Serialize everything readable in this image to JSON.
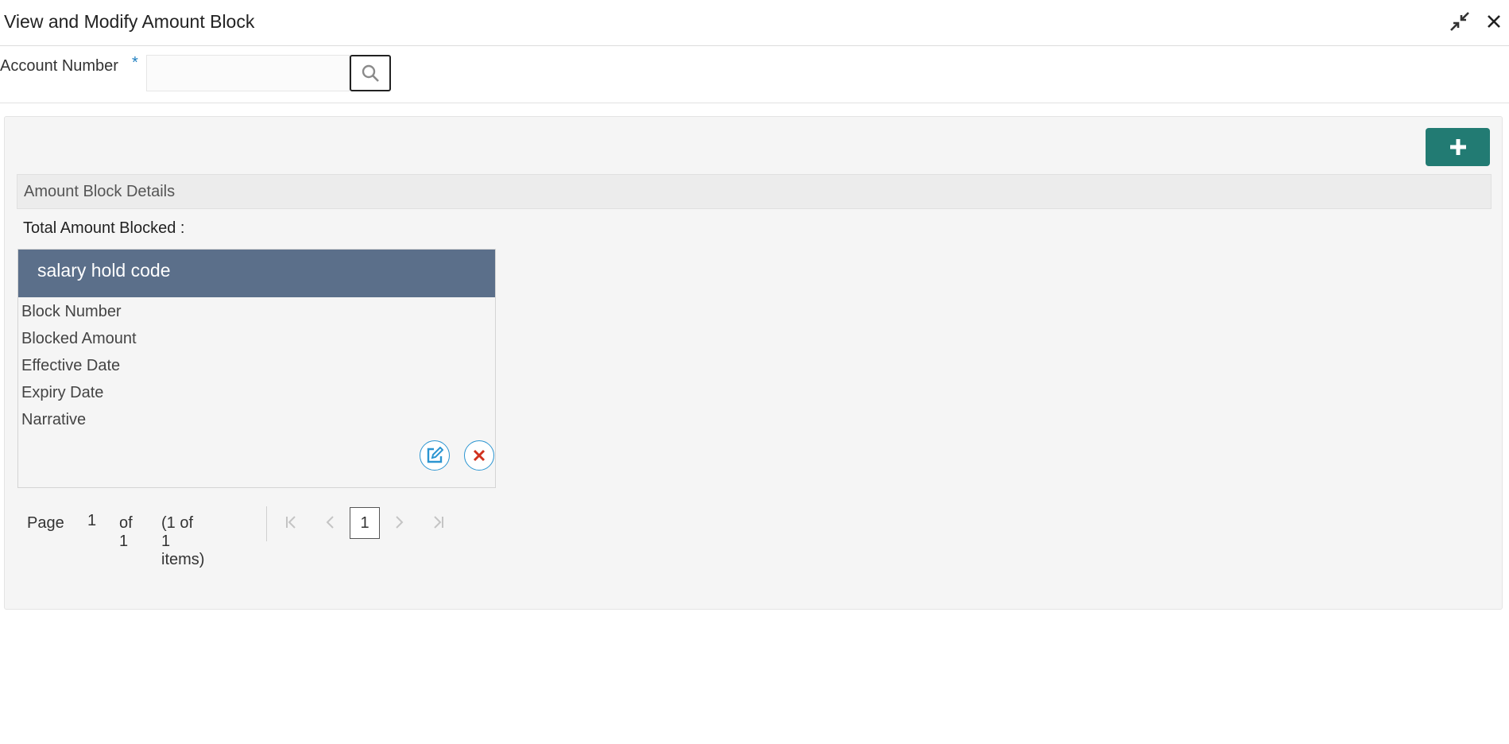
{
  "window": {
    "title": "View and Modify Amount Block",
    "icons": [
      "minimize-arrows-icon",
      "close-icon"
    ]
  },
  "account": {
    "label": "Account Number",
    "required_marker": "*",
    "value": "",
    "search_icon": "search-icon"
  },
  "toolbar": {
    "add_icon": "plus-icon"
  },
  "section": {
    "title": "Amount Block Details",
    "total_label": "Total Amount Blocked :"
  },
  "card": {
    "header": "salary hold code",
    "fields": [
      "Block Number",
      "Blocked Amount",
      "Effective Date",
      "Expiry Date",
      "Narrative"
    ],
    "actions": [
      "edit-icon",
      "delete-icon"
    ]
  },
  "pager": {
    "page_label": "Page",
    "page_value": "1",
    "of_label": "of 1",
    "items_label": "(1 of 1 items)",
    "current": "1"
  },
  "colors": {
    "accent": "#227b73",
    "card_header": "#5b6f8a",
    "link_blue": "#2b95d1",
    "danger": "#d0311e"
  }
}
